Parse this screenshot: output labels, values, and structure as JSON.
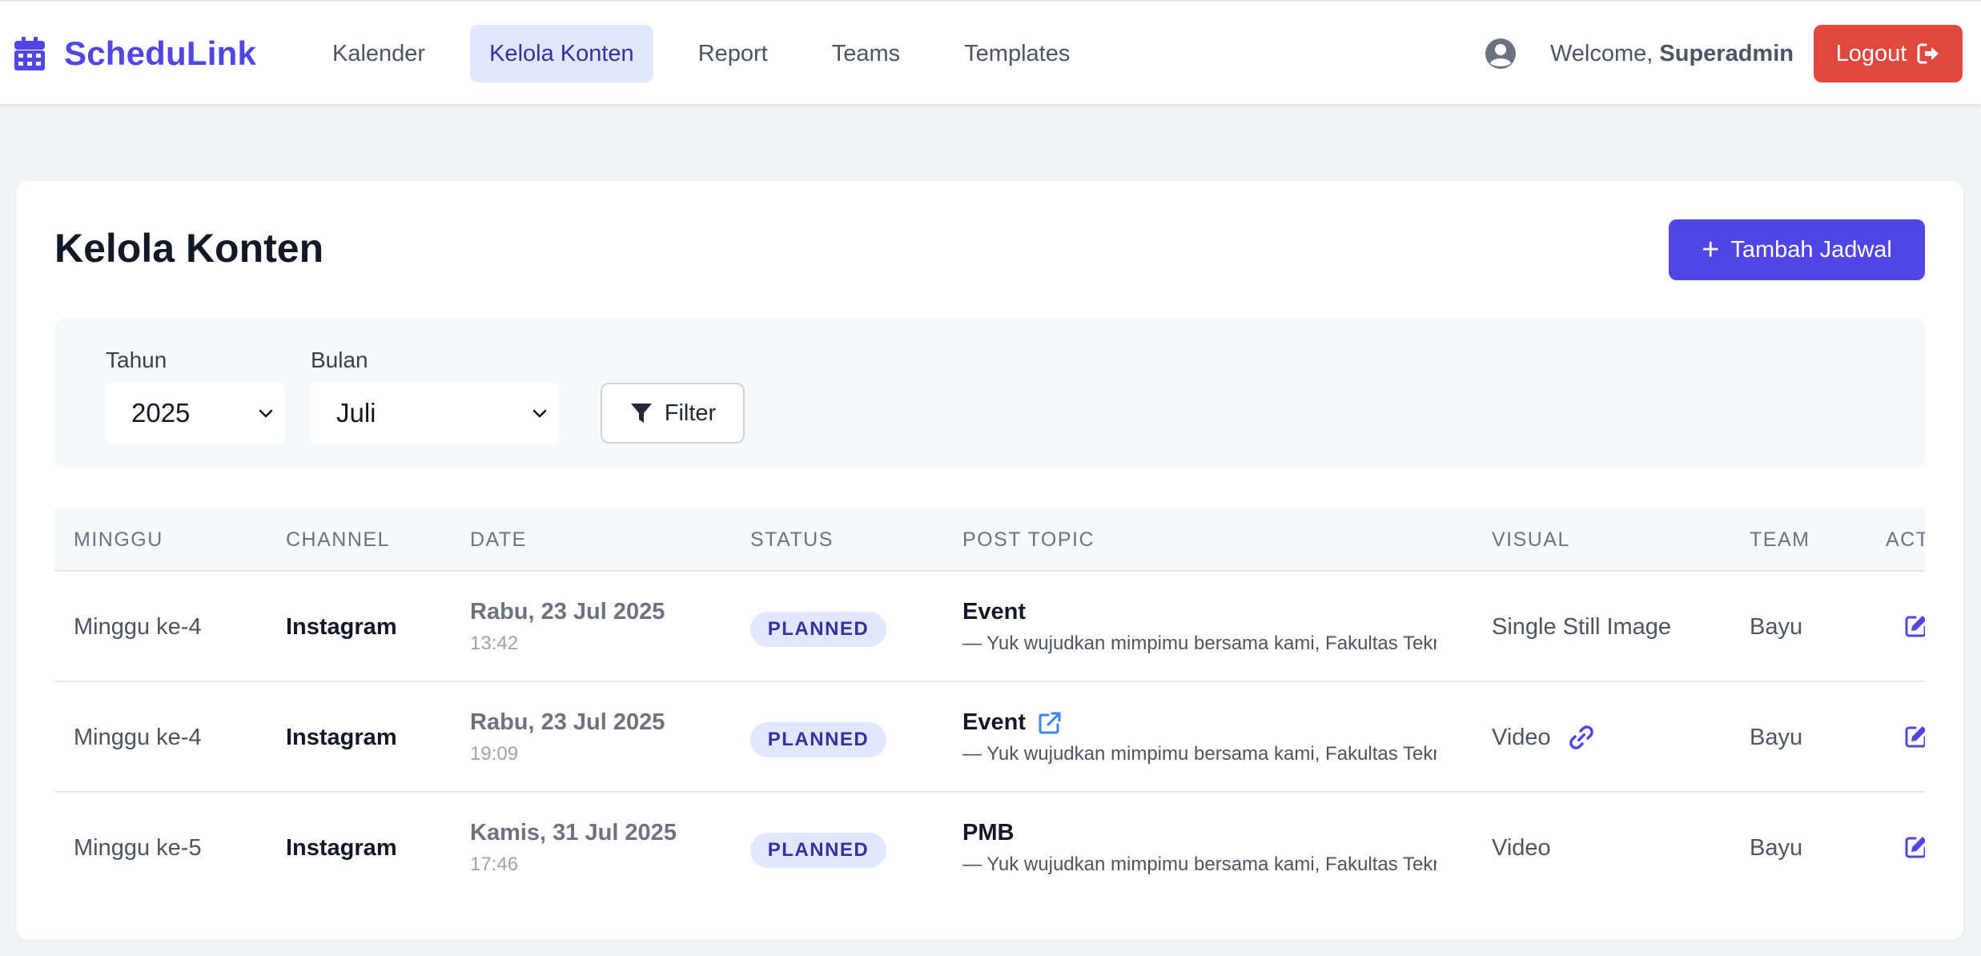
{
  "brand": {
    "name": "ScheduLink",
    "icon": "calendar-icon"
  },
  "nav": {
    "links": [
      {
        "label": "Kalender",
        "active": false
      },
      {
        "label": "Kelola Konten",
        "active": true
      },
      {
        "label": "Report",
        "active": false
      },
      {
        "label": "Teams",
        "active": false
      },
      {
        "label": "Templates",
        "active": false
      }
    ]
  },
  "user": {
    "welcome_prefix": "Welcome,",
    "name": "Superadmin",
    "logout_label": "Logout"
  },
  "page": {
    "title": "Kelola Konten",
    "add_button": "Tambah Jadwal"
  },
  "filters": {
    "year_label": "Tahun",
    "year_value": "2025",
    "month_label": "Bulan",
    "month_value": "Juli",
    "filter_button": "Filter"
  },
  "table": {
    "headers": [
      "MINGGU",
      "CHANNEL",
      "DATE",
      "STATUS",
      "POST TOPIC",
      "VISUAL",
      "TEAM",
      "ACTIONS"
    ],
    "rows": [
      {
        "minggu": "Minggu ke-4",
        "channel": "Instagram",
        "date": "Rabu, 23 Jul 2025",
        "time": "13:42",
        "status": "PLANNED",
        "topic": "Event",
        "desc": "— Yuk wujudkan mimpimu bersama kami, Fakultas Teknik",
        "visual": "Single Still Image",
        "team": "Bayu"
      },
      {
        "minggu": "Minggu ke-4",
        "channel": "Instagram",
        "date": "Rabu, 23 Jul 2025",
        "time": "19:09",
        "status": "PLANNED",
        "topic": "Event",
        "desc": "— Yuk wujudkan mimpimu bersama kami, Fakultas Teknik",
        "visual": "Video",
        "team": "Bayu"
      },
      {
        "minggu": "Minggu ke-5",
        "channel": "Instagram",
        "date": "Kamis, 31 Jul 2025",
        "time": "17:46",
        "status": "PLANNED",
        "topic": "PMB",
        "desc": "— Yuk wujudkan mimpimu bersama kami, Fakultas Teknik",
        "visual": "Video",
        "team": "Bayu"
      }
    ]
  },
  "colors": {
    "accent": "#4f46e5",
    "logout": "#e0483e",
    "badge_bg": "#e0e7ff",
    "badge_text": "#3730a3"
  }
}
